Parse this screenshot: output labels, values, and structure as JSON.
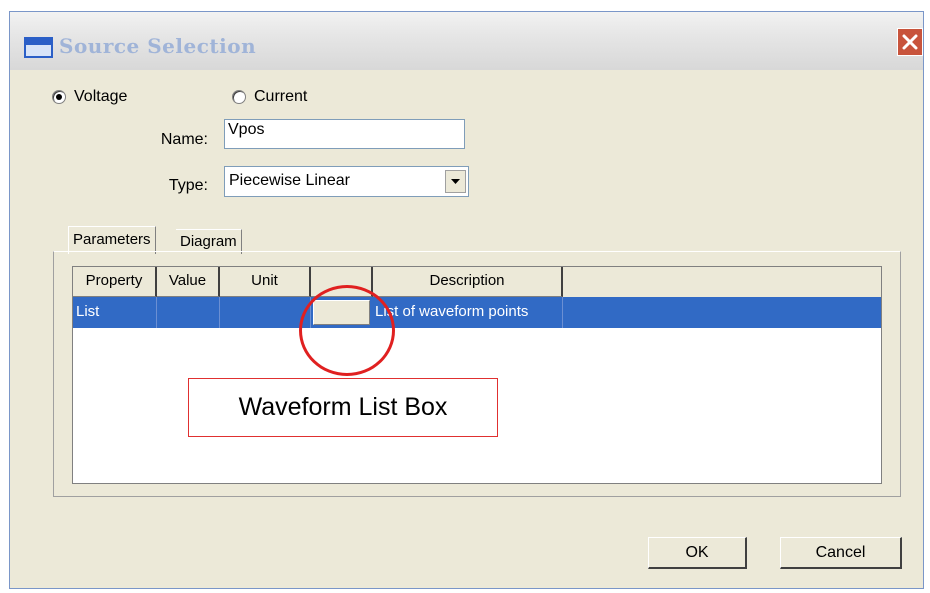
{
  "window": {
    "title": "Source Selection",
    "accent_color": "#316ac5",
    "close_icon": "close-icon"
  },
  "source_type": {
    "voltage_label": "Voltage",
    "current_label": "Current",
    "selected": "Voltage"
  },
  "form": {
    "name_label": "Name:",
    "name_value": "Vpos",
    "type_label": "Type:",
    "type_value": "Piecewise Linear"
  },
  "tabs": [
    {
      "label": "Parameters",
      "active": true
    },
    {
      "label": "Diagram",
      "active": false
    }
  ],
  "grid": {
    "columns": [
      "Property",
      "Value",
      "Unit",
      "",
      "Description"
    ],
    "rows": [
      {
        "property": "List",
        "value": "",
        "unit": "",
        "button": "",
        "description": "List of waveform points",
        "selected": true
      }
    ]
  },
  "buttons": {
    "ok": "OK",
    "cancel": "Cancel"
  },
  "annotation": {
    "callout_text": "Waveform List Box",
    "color": "#e02020"
  }
}
